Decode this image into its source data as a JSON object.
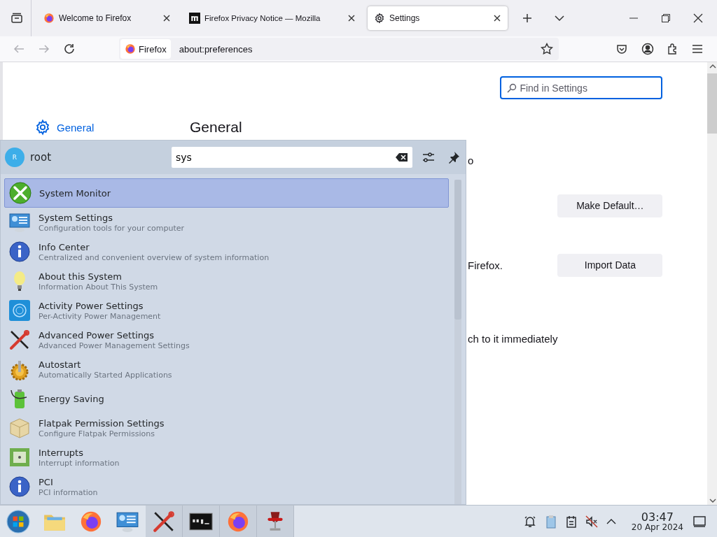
{
  "browser": {
    "tabs": [
      {
        "title": "Welcome to Firefox",
        "selected": false
      },
      {
        "title": "Firefox Privacy Notice — Mozilla",
        "selected": false
      },
      {
        "title": "Settings",
        "selected": true
      }
    ],
    "identity": "Firefox",
    "url": "about:preferences"
  },
  "settings": {
    "search_placeholder": "Find in Settings",
    "nav_item": "General",
    "heading": "General",
    "rows": [
      {
        "text": "o",
        "button": ""
      },
      {
        "text": "",
        "button": "Make Default…"
      },
      {
        "text": "Firefox.",
        "button": "Import Data"
      },
      {
        "text": "ch to it immediately",
        "button": ""
      }
    ]
  },
  "launcher": {
    "avatar": "R",
    "user": "root",
    "query": "sys",
    "results": [
      {
        "name": "System Monitor",
        "selected": true
      },
      {
        "name": "System Settings",
        "description": "Configuration tools for your computer",
        "selected": false
      },
      {
        "name": "Info Center",
        "description": "Centralized and convenient overview of system information",
        "selected": false
      },
      {
        "name": "About this System",
        "description": "Information About This System",
        "selected": false
      },
      {
        "name": "Activity Power Settings",
        "description": "Per-Activity Power Management",
        "selected": false
      },
      {
        "name": "Advanced Power Settings",
        "description": "Advanced Power Management Settings",
        "selected": false
      },
      {
        "name": "Autostart",
        "description": "Automatically Started Applications",
        "selected": false
      },
      {
        "name": "Energy Saving",
        "selected": false
      },
      {
        "name": "Flatpak Permission Settings",
        "description": "Configure Flatpak Permissions",
        "selected": false
      },
      {
        "name": "Interrupts",
        "description": "Interrupt information",
        "selected": false
      },
      {
        "name": "PCI",
        "description": "PCI information",
        "selected": false
      }
    ]
  },
  "taskbar": {
    "apps": [
      {
        "running": false
      },
      {
        "running": false
      },
      {
        "running": false
      },
      {
        "running": false
      },
      {
        "running": true
      },
      {
        "running": true
      },
      {
        "running": true
      },
      {
        "running": true
      }
    ],
    "time": "03:47",
    "date": "20 Apr 2024"
  }
}
